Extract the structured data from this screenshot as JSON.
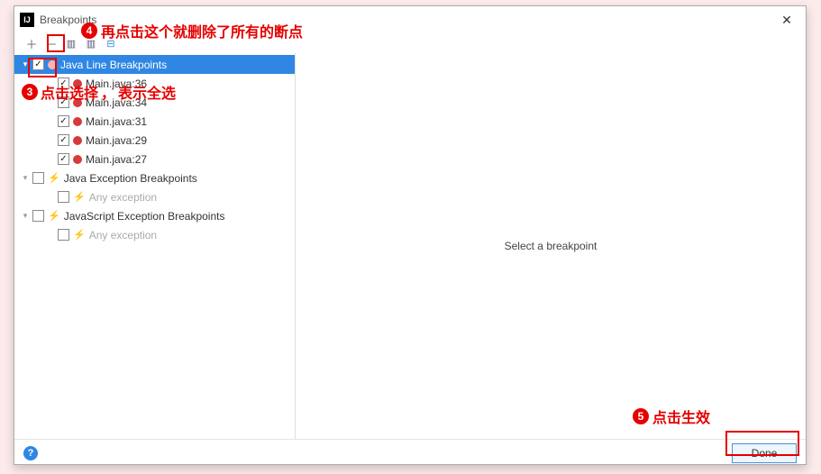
{
  "window": {
    "title": "Breakpoints",
    "close": "✕"
  },
  "toolbar": {
    "add": "＋",
    "remove": "－",
    "group_pkg": "▥",
    "group_file": "▥",
    "collapse": "⊟"
  },
  "tree": {
    "java_line": {
      "label": "Java Line Breakpoints",
      "children": [
        {
          "label": "Main.java:36"
        },
        {
          "label": "Main.java:34"
        },
        {
          "label": "Main.java:31"
        },
        {
          "label": "Main.java:29"
        },
        {
          "label": "Main.java:27"
        }
      ]
    },
    "java_exc": {
      "label": "Java Exception Breakpoints",
      "any": "Any exception"
    },
    "js_exc": {
      "label": "JavaScript Exception Breakpoints",
      "any": "Any exception"
    }
  },
  "detail": {
    "placeholder": "Select a breakpoint"
  },
  "footer": {
    "done": "Done",
    "help": "?"
  },
  "annotations": {
    "n4": "再点击这个就删除了所有的断点",
    "n3a": "点击选择",
    "n3b": "表示全选",
    "n5": "点击生效"
  }
}
